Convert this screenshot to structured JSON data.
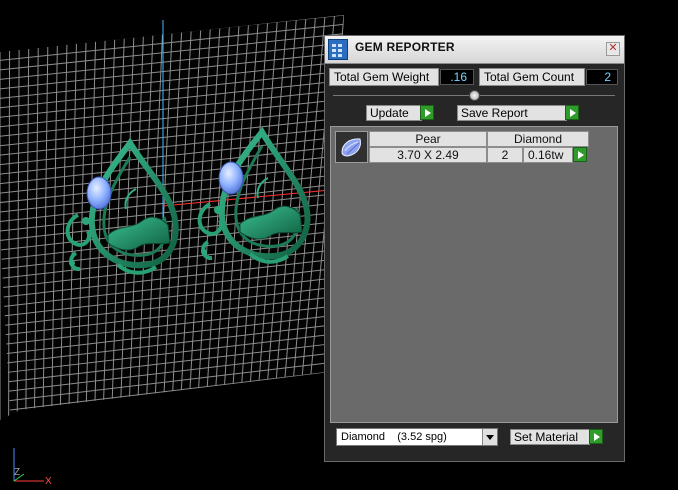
{
  "window": {
    "title": "GEM REPORTER",
    "close_glyph": "✕"
  },
  "stats": {
    "weight_label": "Total Gem Weight",
    "weight_value": ".16",
    "count_label": "Total Gem Count",
    "count_value": "2"
  },
  "toolbar": {
    "update_label": "Update",
    "save_report_label": "Save Report"
  },
  "gem_rows": [
    {
      "shape": "Pear",
      "material": "Diamond",
      "size": "3.70 X 2.49",
      "count": "2",
      "weight": "0.16tw"
    }
  ],
  "material_select": {
    "selected": "Diamond    (3.52 spg)",
    "button_label": "Set Material"
  },
  "axis_gizmo": {
    "z_label": "Z",
    "x_label": "X"
  },
  "icons": {
    "app": "gem-reporter-app-icon",
    "close": "close-icon",
    "thumbnail": "pear-gem-icon",
    "arrow": "green-play-arrow-icon"
  },
  "colors": {
    "panel_bg": "#262626",
    "list_bg": "#6a6a6a",
    "field_text": "#7ad3ff",
    "accent_green": "#2f9b2a",
    "jewel_green": "#1f8a62",
    "gem_blue": "#8fb2ff",
    "grid_line": "#bfbfbf"
  }
}
